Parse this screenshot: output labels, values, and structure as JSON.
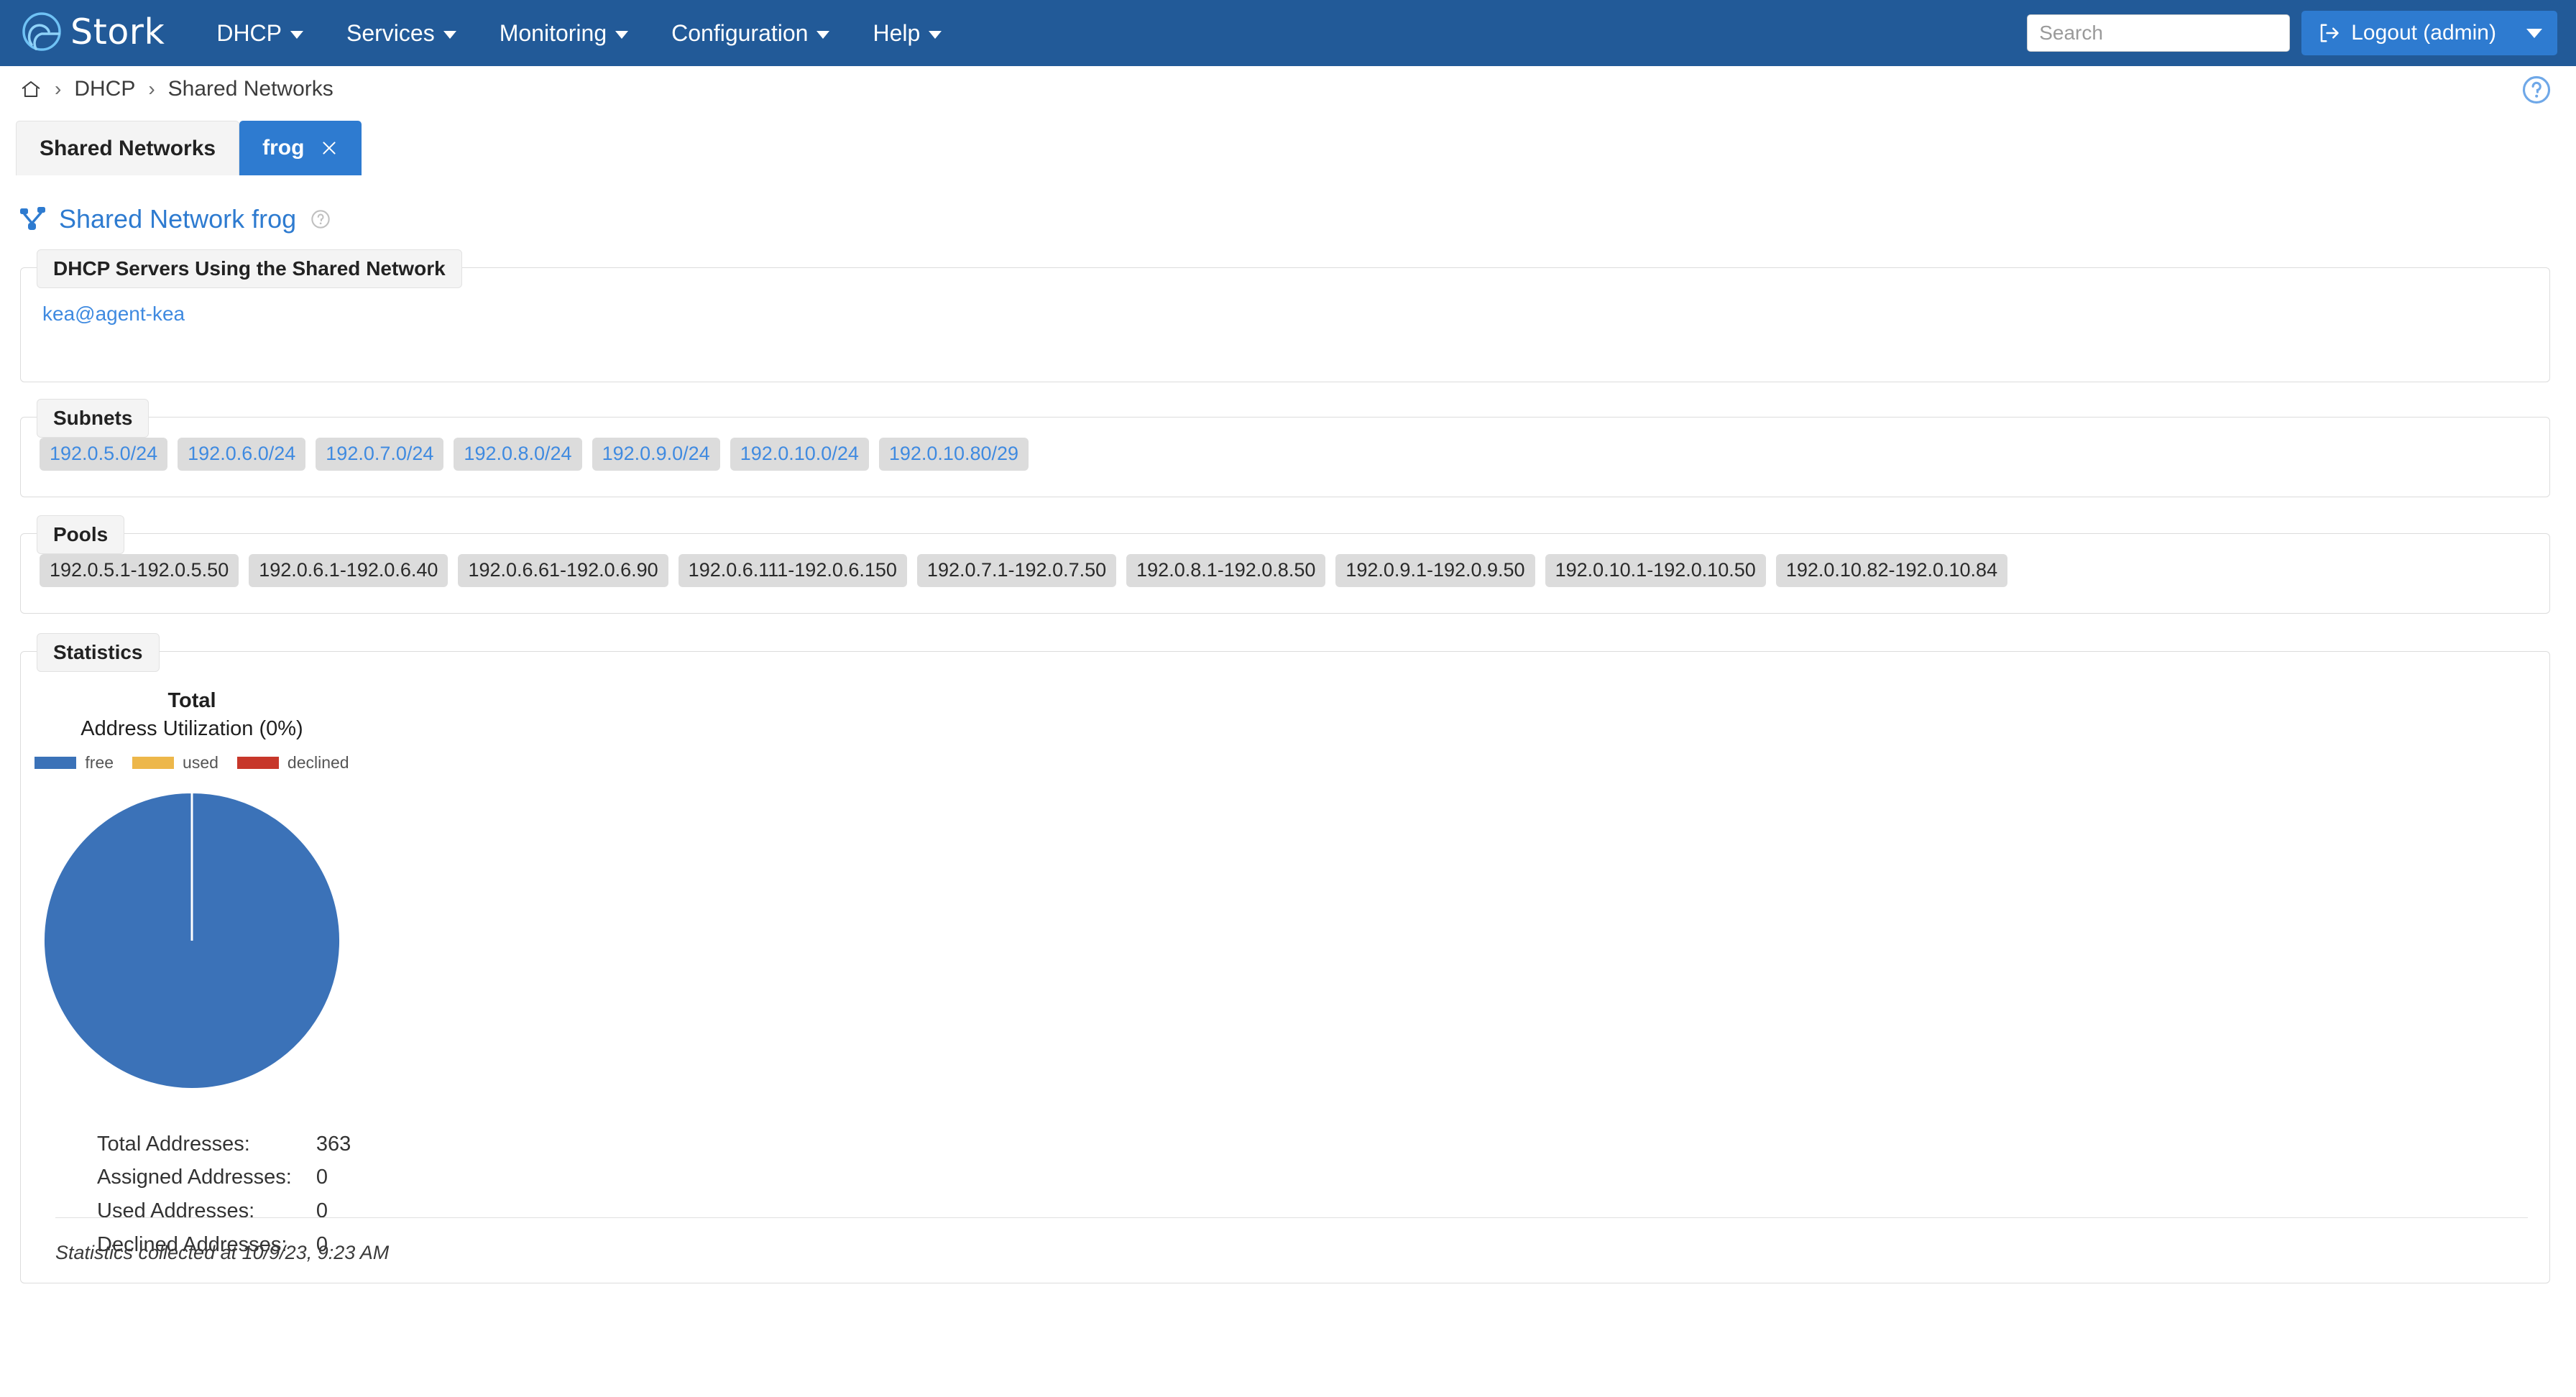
{
  "app": {
    "brand_name": "Stork",
    "accent_color": "#2E7BD0",
    "navbar_color": "#225A98"
  },
  "navbar": {
    "items": [
      {
        "label": "DHCP"
      },
      {
        "label": "Services"
      },
      {
        "label": "Monitoring"
      },
      {
        "label": "Configuration"
      },
      {
        "label": "Help"
      }
    ],
    "search": {
      "placeholder": "Search",
      "value": ""
    },
    "logout_label": "Logout (admin)"
  },
  "breadcrumb": {
    "home_label": "Home",
    "separator": "›",
    "items": [
      {
        "label": "DHCP"
      },
      {
        "label": "Shared Networks"
      }
    ]
  },
  "tabs": [
    {
      "label": "Shared Networks",
      "active": false,
      "closable": false
    },
    {
      "label": "frog",
      "active": true,
      "closable": true
    }
  ],
  "page": {
    "title": "Shared Network frog",
    "title_icon": "sitemap-icon",
    "help_icon": "help-circle-icon"
  },
  "servers_panel": {
    "legend": "DHCP Servers Using the Shared Network",
    "servers": [
      {
        "label": "kea@agent-kea"
      }
    ]
  },
  "subnets_panel": {
    "legend": "Subnets",
    "subnets": [
      "192.0.5.0/24",
      "192.0.6.0/24",
      "192.0.7.0/24",
      "192.0.8.0/24",
      "192.0.9.0/24",
      "192.0.10.0/24",
      "192.0.10.80/29"
    ]
  },
  "pools_panel": {
    "legend": "Pools",
    "pools": [
      "192.0.5.1-192.0.5.50",
      "192.0.6.1-192.0.6.40",
      "192.0.6.61-192.0.6.90",
      "192.0.6.111-192.0.6.150",
      "192.0.7.1-192.0.7.50",
      "192.0.8.1-192.0.8.50",
      "192.0.9.1-192.0.9.50",
      "192.0.10.1-192.0.10.50",
      "192.0.10.82-192.0.10.84"
    ]
  },
  "statistics_panel": {
    "legend": "Statistics",
    "rows": [
      {
        "label": "Total Addresses:",
        "value": "363"
      },
      {
        "label": "Assigned Addresses:",
        "value": "0"
      },
      {
        "label": "Used Addresses:",
        "value": "0"
      },
      {
        "label": "Declined Addresses:",
        "value": "0"
      }
    ],
    "footnote": "Statistics collected at 10/9/23, 9:23 AM"
  },
  "chart_data": {
    "type": "pie",
    "title": "Total",
    "subtitle": "Address Utilization (0%)",
    "categories": [
      "free",
      "used",
      "declined"
    ],
    "values": [
      363,
      0,
      0
    ],
    "colors": [
      "#3B72B8",
      "#EDB74A",
      "#C7372A"
    ],
    "legend_position": "top",
    "total": 363,
    "utilization_percent": 0
  }
}
